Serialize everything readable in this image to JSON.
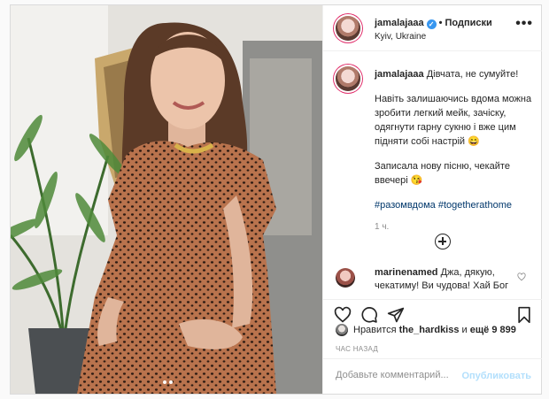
{
  "post": {
    "username": "jamalajaaa",
    "follow_label": "Подписки",
    "location": "Kyiv, Ukraine",
    "more_label": "•••",
    "verified_mark": "✓"
  },
  "caption": {
    "username": "jamalajaaa",
    "line1": "Дівчата, не сумуйте!",
    "paragraph1": "Навіть залишаючись вдома можна зробити легкий мейк, зачіску, одягнути гарну сукню і вже цим підняти собі настрій 😄",
    "paragraph2": "Записала нову пісню, чекайте ввечері 😘",
    "hashtags": "#разомвдома #togetherathome",
    "time_ago": "1 ч."
  },
  "comment": {
    "username": "marinenamed",
    "text": "Джа, дякую, чекатиму! Ви чудова! Хай Бог"
  },
  "likes": {
    "prefix": "Нравится",
    "user": "the_hardkiss",
    "middle": "и",
    "others": "ещё 9 899"
  },
  "posted_ago": "ЧАС НАЗАД",
  "add_comment": {
    "placeholder": "Добавьте комментарий...",
    "publish_label": "Опубликовать"
  },
  "colors": {
    "accent": "#3897f0",
    "publish_disabled": "#b2dffc",
    "hashtag": "#00376b"
  },
  "icons": [
    "heart-icon",
    "comment-icon",
    "share-icon",
    "bookmark-icon",
    "more-icon",
    "add-circle-icon",
    "verified-icon"
  ]
}
